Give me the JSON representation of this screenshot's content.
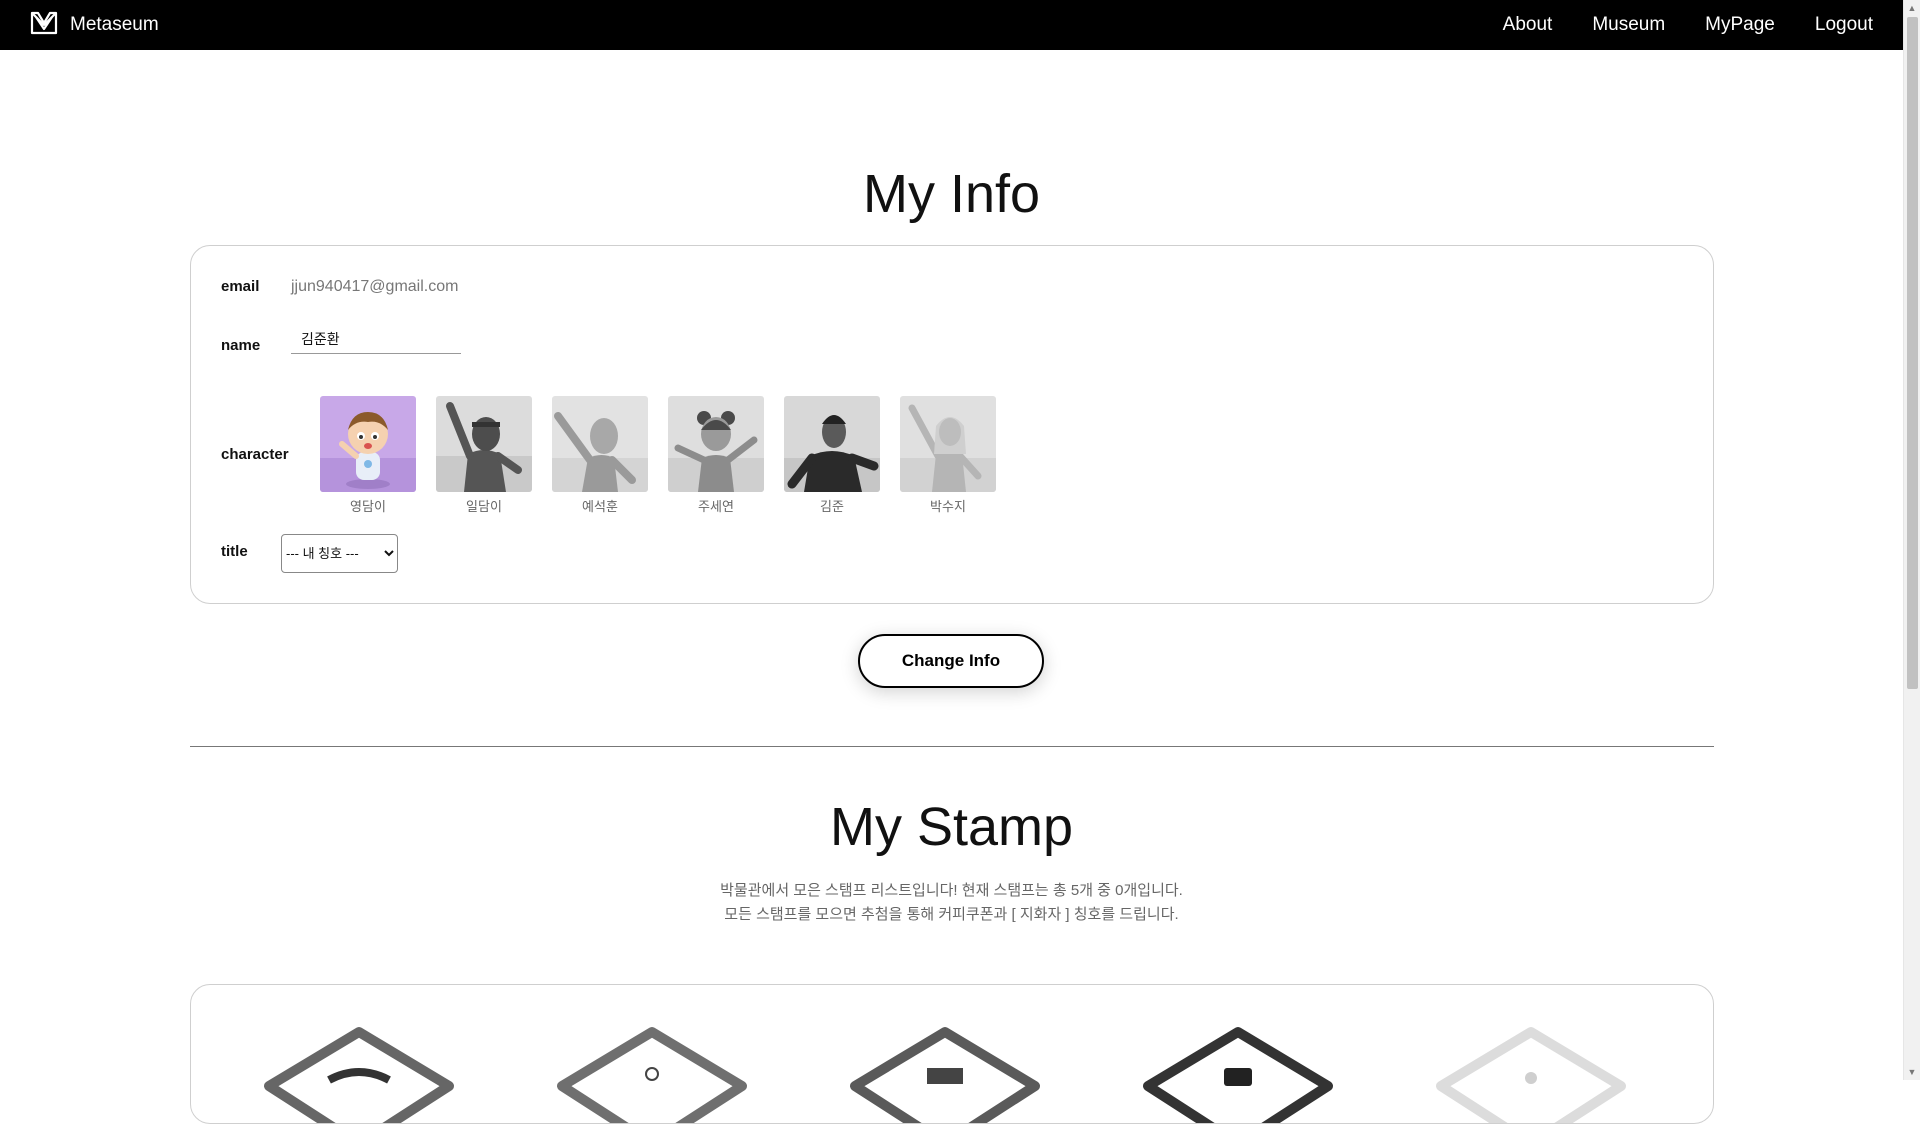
{
  "navbar": {
    "brand": "Metaseum",
    "links": [
      "About",
      "Museum",
      "MyPage",
      "Logout"
    ]
  },
  "my_info": {
    "title": "My Info",
    "email_label": "email",
    "email_value": "jjun940417@gmail.com",
    "name_label": "name",
    "name_value": "김준환",
    "character_label": "character",
    "characters": [
      "영담이",
      "일담이",
      "예석훈",
      "주세연",
      "김준",
      "박수지"
    ],
    "title_label": "title",
    "title_select_value": "--- 내 칭호 ---",
    "change_button": "Change Info"
  },
  "my_stamp": {
    "title": "My Stamp",
    "desc_line1": "박물관에서 모은 스탬프 리스트입니다! 현재 스탬프는 총 5개 중 0개입니다.",
    "desc_line2": "모든 스탬프를 모으면 추첨을 통해 커피쿠폰과 [ 지화자 ] 칭호를 드립니다.",
    "stamp_count": 5
  },
  "colors": {
    "navbar_bg": "#000000",
    "selected_character_bg": "#c8a8e8",
    "card_border": "#cfcfcf"
  }
}
